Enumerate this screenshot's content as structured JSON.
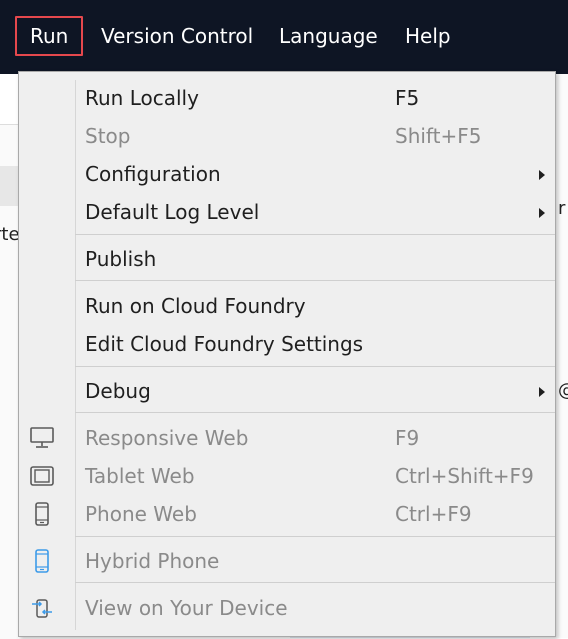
{
  "menubar": {
    "items": [
      {
        "label": "Run",
        "active": true
      },
      {
        "label": "Version Control"
      },
      {
        "label": "Language"
      },
      {
        "label": "Help"
      }
    ]
  },
  "background": {
    "fragment_left": "rte",
    "fragment_right": "r",
    "fragment_right2": "@"
  },
  "run_menu": {
    "items": [
      {
        "label": "Run Locally",
        "shortcut": "F5",
        "enabled": true
      },
      {
        "label": "Stop",
        "shortcut": "Shift+F5",
        "enabled": false
      },
      {
        "label": "Configuration",
        "submenu": true,
        "enabled": true
      },
      {
        "label": "Default Log Level",
        "submenu": true,
        "enabled": true
      },
      {
        "label": "Publish",
        "enabled": true
      },
      {
        "label": "Run on Cloud Foundry",
        "enabled": true
      },
      {
        "label": "Edit Cloud Foundry Settings",
        "enabled": true
      },
      {
        "label": "Debug",
        "submenu": true,
        "enabled": true
      },
      {
        "label": "Responsive Web",
        "shortcut": "F9",
        "icon": "monitor-icon",
        "enabled": false
      },
      {
        "label": "Tablet Web",
        "shortcut": "Ctrl+Shift+F9",
        "icon": "tablet-icon",
        "enabled": false
      },
      {
        "label": "Phone Web",
        "shortcut": "Ctrl+F9",
        "icon": "phone-icon",
        "enabled": false
      },
      {
        "label": "Hybrid Phone",
        "icon": "hybrid-phone-icon",
        "enabled": false
      },
      {
        "label": "View on Your Device",
        "icon": "device-sync-icon",
        "enabled": false
      }
    ]
  },
  "colors": {
    "menubar_bg": "#0e1524",
    "active_border": "#e5484d",
    "menu_bg": "#efefef",
    "disabled_text": "#8a8a8a",
    "hybrid_icon": "#3d9be9"
  }
}
